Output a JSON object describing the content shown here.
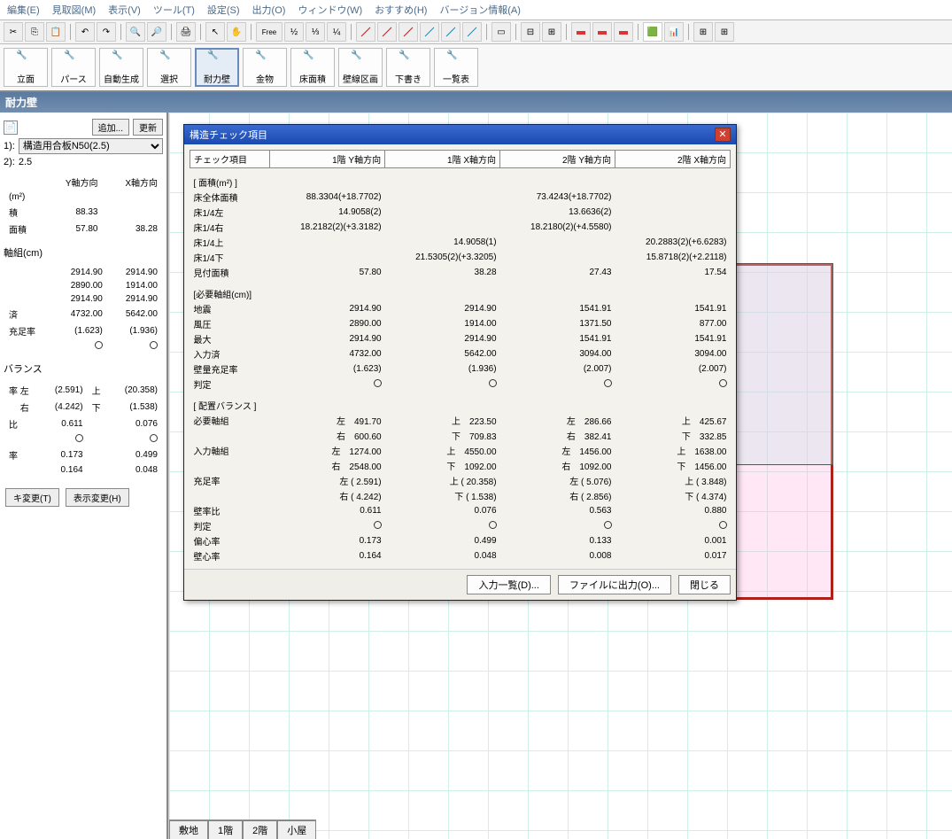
{
  "menu": [
    "編集(E)",
    "見取図(M)",
    "表示(V)",
    "ツール(T)",
    "設定(S)",
    "出力(O)",
    "ウィンドウ(W)",
    "おすすめ(H)",
    "バージョン情報(A)"
  ],
  "bigButtons": [
    {
      "label": "立面"
    },
    {
      "label": "パース"
    },
    {
      "label": "自動生成"
    },
    {
      "label": "選択"
    },
    {
      "label": "耐力壁",
      "active": true
    },
    {
      "label": "金物"
    },
    {
      "label": "床面積"
    },
    {
      "label": "壁線区画"
    },
    {
      "label": "下書き"
    },
    {
      "label": "一覧表"
    }
  ],
  "title": "耐力壁",
  "sidebar": {
    "btn_add": "追加...",
    "btn_upd": "更新",
    "sel_label": "1):",
    "sel_value": "構造用合板N50(2.5)",
    "val_label": "2):",
    "val_value": "2.5",
    "hdr_y": "Y軸方向",
    "hdr_x": "X軸方向",
    "rows1": [
      {
        "l": "(m²)",
        "y": "",
        "x": ""
      },
      {
        "l": "積",
        "y": "88.33",
        "x": ""
      },
      {
        "l": "面積",
        "y": "57.80",
        "x": "38.28"
      }
    ],
    "sect2": "軸組(cm)",
    "rows2": [
      {
        "l": "",
        "y": "2914.90",
        "x": "2914.90"
      },
      {
        "l": "",
        "y": "2890.00",
        "x": "1914.00"
      },
      {
        "l": "",
        "y": "2914.90",
        "x": "2914.90"
      },
      {
        "l": "済",
        "y": "4732.00",
        "x": "5642.00"
      },
      {
        "l": "充足率",
        "y": "(1.623)",
        "x": "(1.936)"
      },
      {
        "l": "",
        "y": "○",
        "x": "○"
      }
    ],
    "sect3": "バランス",
    "rows3": [
      {
        "l": "率 左",
        "a": "(2.591)",
        "b": "上",
        "c": "(20.358)"
      },
      {
        "l": "　 右",
        "a": "(4.242)",
        "b": "下",
        "c": "(1.538)"
      },
      {
        "l": "比",
        "a": "0.611",
        "b": "",
        "c": "0.076"
      },
      {
        "l": "",
        "a": "○",
        "b": "",
        "c": "○"
      },
      {
        "l": "率",
        "a": "0.173",
        "b": "",
        "c": "0.499"
      },
      {
        "l": "",
        "a": "0.164",
        "b": "",
        "c": "0.048"
      }
    ],
    "btn_edit": "キ変更(T)",
    "btn_disp": "表示変更(H)"
  },
  "canvas": {
    "tabs": [
      "敷地",
      "1階",
      "2階",
      "小屋"
    ]
  },
  "dialog": {
    "title": "構造チェック項目",
    "headers": [
      "チェック項目",
      "1階 Y軸方向",
      "1階 X軸方向",
      "2階 Y軸方向",
      "2階 X軸方向"
    ],
    "sect1": "[ 面積(m²) ]",
    "rows1": [
      [
        "床全体面積",
        "88.3304(+18.7702)",
        "",
        "73.4243(+18.7702)",
        ""
      ],
      [
        "床1/4左",
        "14.9058(2)",
        "",
        "13.6636(2)",
        ""
      ],
      [
        "床1/4右",
        "18.2182(2)(+3.3182)",
        "",
        "18.2180(2)(+4.5580)",
        ""
      ],
      [
        "床1/4上",
        "",
        "14.9058(1)",
        "",
        "20.2883(2)(+6.6283)"
      ],
      [
        "床1/4下",
        "",
        "21.5305(2)(+3.3205)",
        "",
        "15.8718(2)(+2.2118)"
      ],
      [
        "見付面積",
        "57.80",
        "38.28",
        "27.43",
        "17.54"
      ]
    ],
    "sect2": "[必要軸組(cm)]",
    "rows2": [
      [
        "地震",
        "2914.90",
        "2914.90",
        "1541.91",
        "1541.91"
      ],
      [
        "風圧",
        "2890.00",
        "1914.00",
        "1371.50",
        "877.00"
      ],
      [
        "最大",
        "2914.90",
        "2914.90",
        "1541.91",
        "1541.91"
      ],
      [
        "入力済",
        "4732.00",
        "5642.00",
        "3094.00",
        "3094.00"
      ],
      [
        "壁量充足率",
        "(1.623)",
        "(1.936)",
        "(2.007)",
        "(2.007)"
      ],
      [
        "判定",
        "○",
        "○",
        "○",
        "○"
      ]
    ],
    "sect3": "[ 配置バランス ]",
    "rows3": [
      [
        "必要軸組",
        "左　491.70",
        "上　223.50",
        "左　286.66",
        "上　425.67"
      ],
      [
        "",
        "右　600.60",
        "下　709.83",
        "右　382.41",
        "下　332.85"
      ],
      [
        "入力軸組",
        "左　1274.00",
        "上　4550.00",
        "左　1456.00",
        "上　1638.00"
      ],
      [
        "",
        "右　2548.00",
        "下　1092.00",
        "右　1092.00",
        "下　1456.00"
      ],
      [
        "充足率",
        "左 ( 2.591)",
        "上 ( 20.358)",
        "左 ( 5.076)",
        "上 ( 3.848)"
      ],
      [
        "",
        "右 ( 4.242)",
        "下 ( 1.538)",
        "右 ( 2.856)",
        "下 ( 4.374)"
      ],
      [
        "壁率比",
        "0.611",
        "0.076",
        "0.563",
        "0.880"
      ],
      [
        "判定",
        "○",
        "○",
        "○",
        "○"
      ],
      [
        "偏心率",
        "0.173",
        "0.499",
        "0.133",
        "0.001"
      ],
      [
        "壁心率",
        "0.164",
        "0.048",
        "0.008",
        "0.017"
      ]
    ],
    "btn_list": "入力一覧(D)...",
    "btn_out": "ファイルに出力(O)...",
    "btn_close": "閉じる"
  }
}
